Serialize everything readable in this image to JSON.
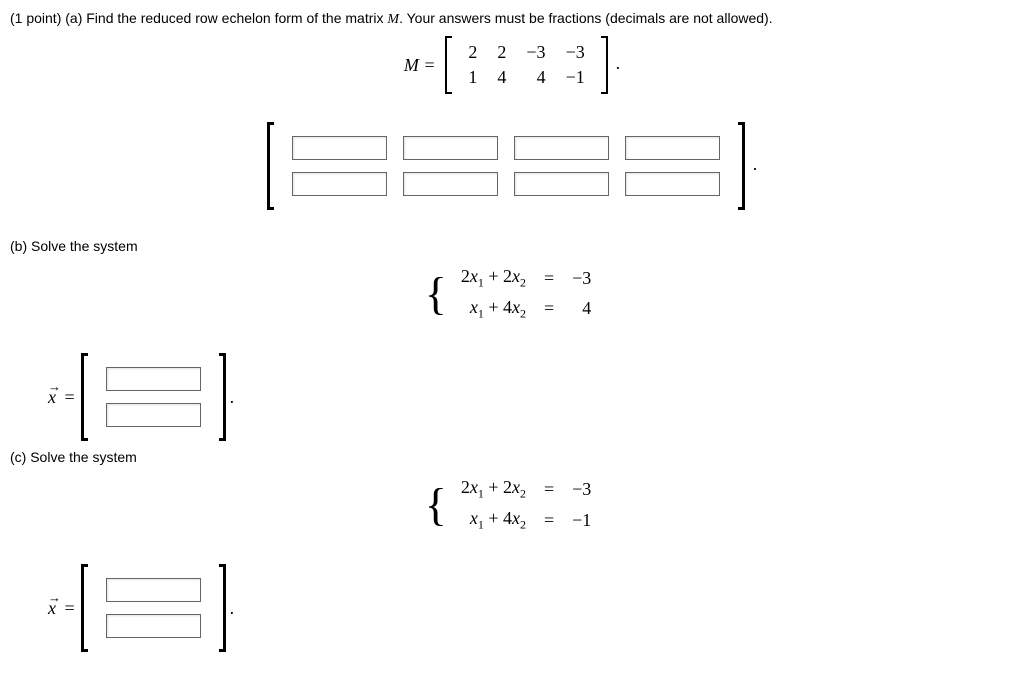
{
  "problem": {
    "points_prefix": "(1 point) ",
    "part_a_label": "(a) ",
    "part_a_text_before_M": "Find the reduced row echelon form of the matrix ",
    "M": "M",
    "part_a_text_after_M": ". Your answers must be fractions (decimals are not allowed).",
    "M_equals": "M =",
    "matrix_M": [
      [
        "2",
        "2",
        "−3",
        "−3"
      ],
      [
        "1",
        "4",
        "4",
        "−1"
      ]
    ],
    "period": "."
  },
  "part_b": {
    "label": "(b) Solve the system",
    "system": [
      {
        "lhs": "2x₁ + 2x₂",
        "eq": "=",
        "rhs": "−3"
      },
      {
        "lhs": "x₁ + 4x₂",
        "eq": "=",
        "rhs": "4"
      }
    ],
    "vector_label": "x",
    "equals": "=",
    "period": "."
  },
  "part_c": {
    "label": "(c) Solve the system",
    "system": [
      {
        "lhs": "2x₁ + 2x₂",
        "eq": "=",
        "rhs": "−3"
      },
      {
        "lhs": "x₁ + 4x₂",
        "eq": "=",
        "rhs": "−1"
      }
    ],
    "vector_label": "x",
    "equals": "=",
    "period": "."
  },
  "chart_data": {
    "type": "table",
    "title": "Matrix M for RREF problem",
    "rows": 2,
    "cols": 4,
    "values": [
      [
        2,
        2,
        -3,
        -3
      ],
      [
        1,
        4,
        4,
        -1
      ]
    ]
  }
}
